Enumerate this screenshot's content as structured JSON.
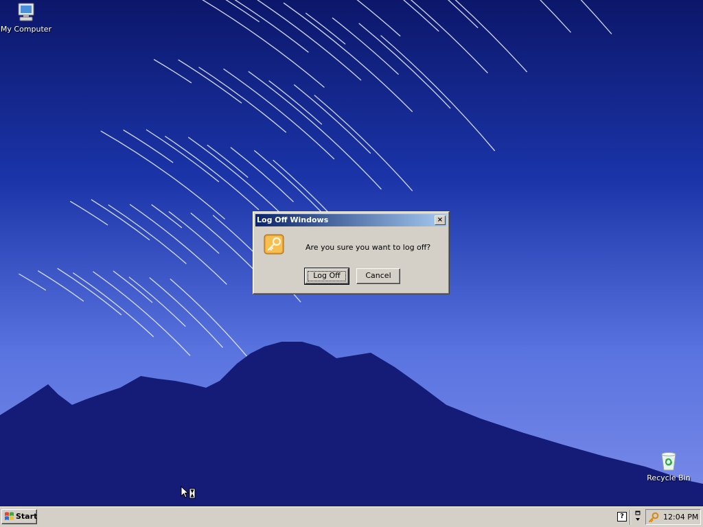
{
  "desktop": {
    "icons": [
      {
        "label": "My Computer",
        "icon": "my-computer-icon"
      },
      {
        "label": "Recycle Bin",
        "icon": "recycle-bin-icon"
      }
    ]
  },
  "dialog": {
    "title": "Log Off Windows",
    "close_label": "×",
    "message": "Are you sure you want to log off?",
    "icon": "key-icon",
    "buttons": {
      "logoff": "Log Off",
      "cancel": "Cancel"
    }
  },
  "taskbar": {
    "start_label": "Start",
    "help_label": "?",
    "tray": {
      "clock": "12:04 PM"
    }
  },
  "colors": {
    "titlebar_start": "#0a246a",
    "titlebar_end": "#a6caf0",
    "face": "#d4d0c8",
    "sky_top": "#0d1a6e",
    "sky_horizon": "#4d67da",
    "mountain": "#141c78"
  }
}
